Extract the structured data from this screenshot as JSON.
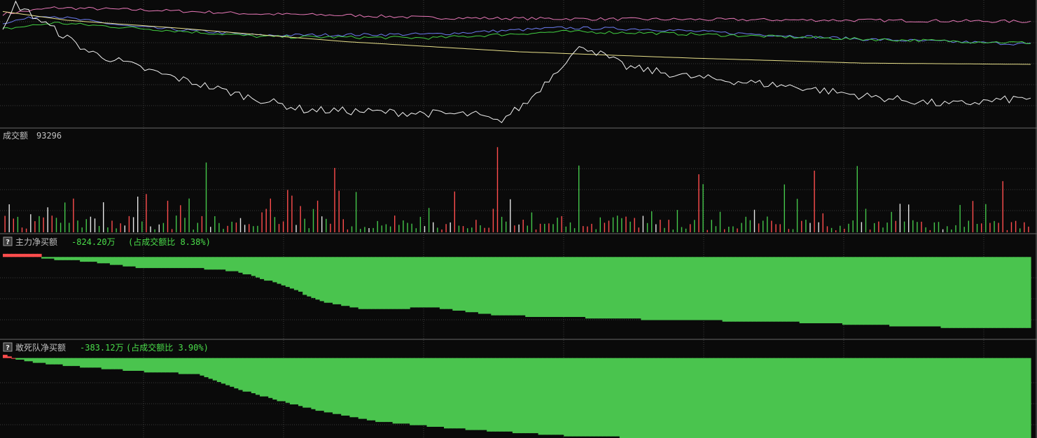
{
  "colors": {
    "background": "#0a0a0a",
    "grid": "#3a3a3a",
    "separator": "#6a6a6a",
    "label_gray": "#c0c0c0",
    "value_green": "#4ade4a",
    "up_red": "#ff4d4d",
    "down_green": "#44c64a",
    "neutral_white": "#e6e6e6",
    "line_pink": "#e878b8",
    "line_blue": "#6c7cf0",
    "line_green": "#42d042",
    "line_yellow": "#e8e08a",
    "line_white": "#f2f2f2",
    "fill_green": "#4ac44e",
    "fill_red": "#ff4d4d"
  },
  "panels": {
    "volume": {
      "label": "成交额",
      "value": "93296"
    },
    "main_force": {
      "label": "主力净买额",
      "value": "-824.20万",
      "ratio": "(占成交额比 8.38%)"
    },
    "dare_to_die": {
      "label": "敢死队净买额",
      "value": "-383.12万",
      "ratio": "(占成交额比 3.90%)"
    }
  },
  "chart_data": [
    {
      "type": "line",
      "title": "",
      "x": {
        "count": 240,
        "label": "minute index"
      },
      "ylim": [
        0,
        100
      ],
      "grid": true,
      "series": [
        {
          "color": "pink",
          "anchors": [
            [
              0,
              90
            ],
            [
              12,
              95
            ],
            [
              35,
              93
            ],
            [
              60,
              90
            ],
            [
              80,
              89
            ],
            [
              100,
              87
            ],
            [
              140,
              86
            ],
            [
              200,
              85
            ],
            [
              240,
              84
            ]
          ]
        },
        {
          "color": "blue",
          "anchors": [
            [
              0,
              83
            ],
            [
              10,
              89
            ],
            [
              30,
              80
            ],
            [
              60,
              73
            ],
            [
              100,
              74
            ],
            [
              130,
              79
            ],
            [
              150,
              78
            ],
            [
              200,
              70
            ],
            [
              240,
              66
            ]
          ]
        },
        {
          "color": "green",
          "anchors": [
            [
              0,
              78
            ],
            [
              12,
              83
            ],
            [
              30,
              79
            ],
            [
              60,
              72
            ],
            [
              100,
              71
            ],
            [
              130,
              76
            ],
            [
              150,
              75
            ],
            [
              200,
              70
            ],
            [
              240,
              67
            ]
          ]
        },
        {
          "color": "yellow",
          "anchors": [
            [
              0,
              92
            ],
            [
              15,
              85
            ],
            [
              40,
              79
            ],
            [
              80,
              68
            ],
            [
              120,
              60
            ],
            [
              160,
              55
            ],
            [
              200,
              51
            ],
            [
              240,
              50
            ]
          ]
        },
        {
          "color": "white",
          "anchors": [
            [
              0,
              75
            ],
            [
              3,
              98
            ],
            [
              10,
              82
            ],
            [
              20,
              60
            ],
            [
              35,
              44
            ],
            [
              55,
              26
            ],
            [
              70,
              14
            ],
            [
              90,
              12
            ],
            [
              110,
              10
            ],
            [
              115,
              4
            ],
            [
              122,
              20
            ],
            [
              130,
              50
            ],
            [
              135,
              65
            ],
            [
              145,
              48
            ],
            [
              160,
              40
            ],
            [
              185,
              32
            ],
            [
              200,
              25
            ],
            [
              220,
              18
            ],
            [
              240,
              24
            ]
          ]
        }
      ]
    },
    {
      "type": "bar",
      "title": "成交额",
      "value": 93296,
      "ylim": [
        0,
        100
      ],
      "count": 240,
      "colors_by_direction": {
        "up": "red",
        "down": "green",
        "flat": "white"
      }
    },
    {
      "type": "area",
      "title": "主力净买额",
      "value": "-824.20万",
      "ratio": "8.38%",
      "ylim": [
        -100,
        10
      ],
      "anchors": [
        [
          0,
          4
        ],
        [
          8,
          3
        ],
        [
          9,
          -2
        ],
        [
          20,
          -6
        ],
        [
          32,
          -14
        ],
        [
          44,
          -14
        ],
        [
          54,
          -18
        ],
        [
          64,
          -34
        ],
        [
          75,
          -58
        ],
        [
          85,
          -67
        ],
        [
          100,
          -64
        ],
        [
          115,
          -74
        ],
        [
          135,
          -77
        ],
        [
          155,
          -80
        ],
        [
          180,
          -82
        ],
        [
          200,
          -86
        ],
        [
          230,
          -91
        ],
        [
          240,
          -90
        ]
      ]
    },
    {
      "type": "area",
      "title": "敢死队净买额",
      "value": "-383.12万",
      "ratio": "3.90%",
      "ylim": [
        -100,
        5
      ],
      "anchors": [
        [
          0,
          3
        ],
        [
          3,
          -2
        ],
        [
          6,
          -5
        ],
        [
          15,
          -10
        ],
        [
          25,
          -14
        ],
        [
          35,
          -18
        ],
        [
          45,
          -20
        ],
        [
          55,
          -40
        ],
        [
          65,
          -55
        ],
        [
          75,
          -68
        ],
        [
          88,
          -80
        ],
        [
          100,
          -86
        ],
        [
          115,
          -92
        ],
        [
          130,
          -97
        ],
        [
          150,
          -100
        ],
        [
          240,
          -100
        ]
      ]
    }
  ]
}
